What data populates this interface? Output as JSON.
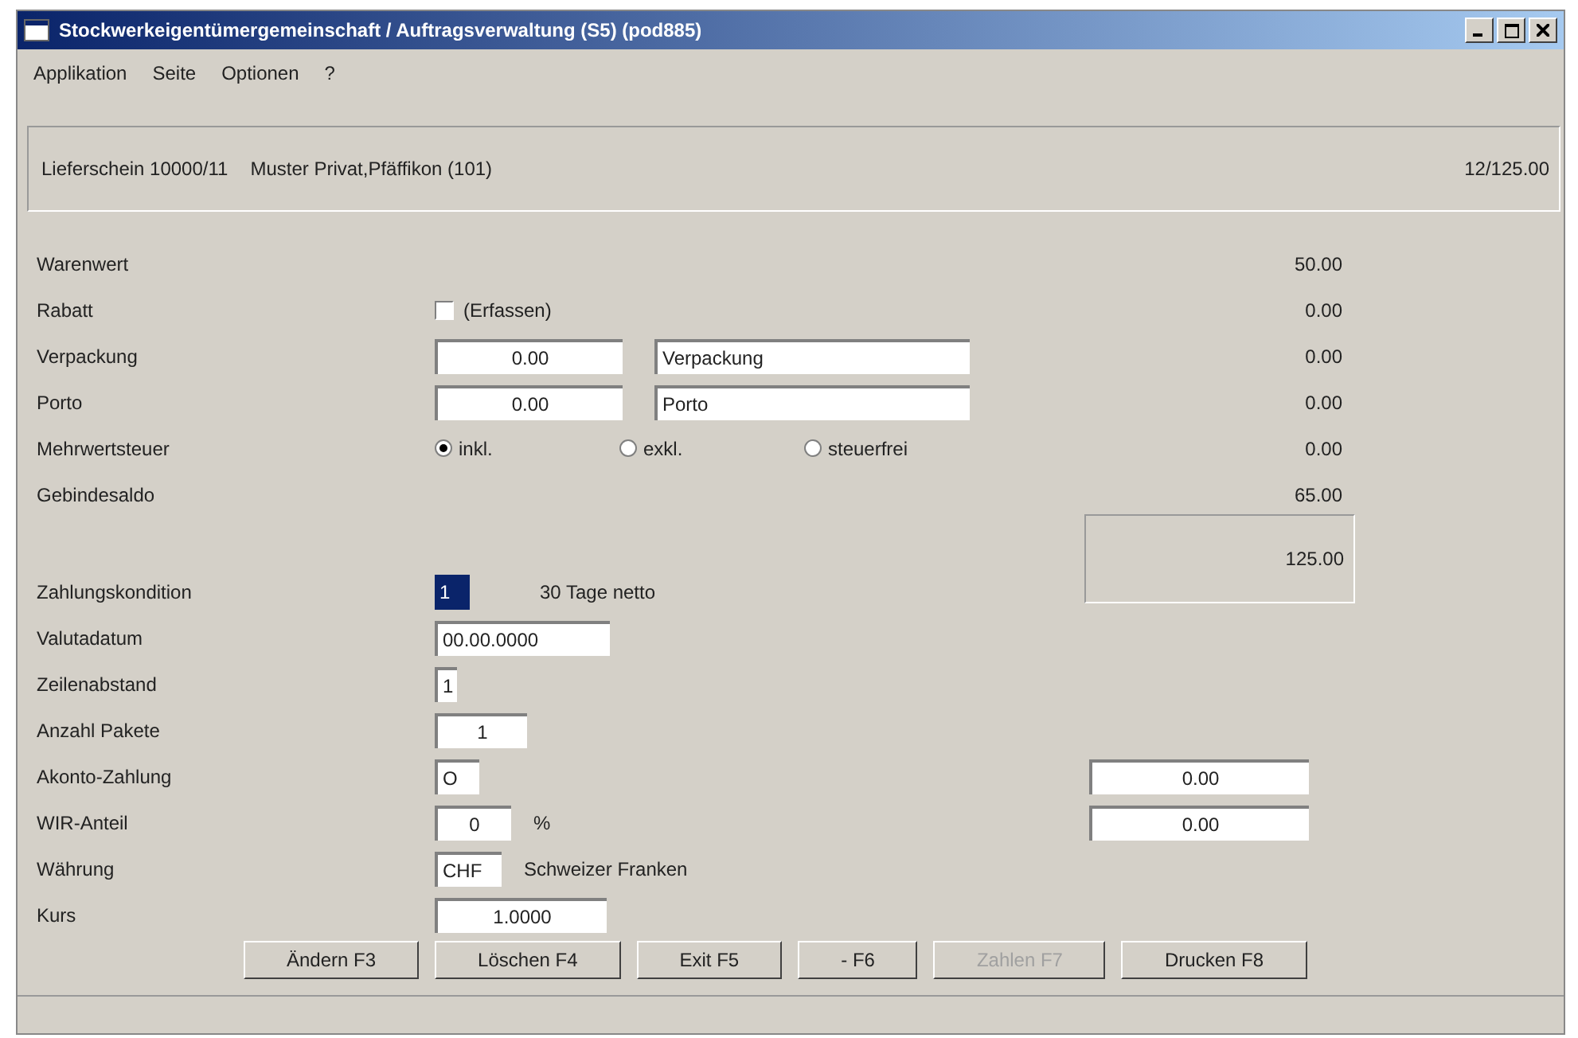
{
  "window": {
    "title": "Stockwerkeigentümergemeinschaft / Auftragsverwaltung (S5) (pod885)"
  },
  "menu": [
    {
      "label": "Applikation"
    },
    {
      "label": "Seite"
    },
    {
      "label": "Optionen"
    },
    {
      "label": "?"
    }
  ],
  "header": {
    "document": "Lieferschein 10000/11",
    "customer": "Muster Privat,Pfäffikon (101)",
    "total": "12/125.00"
  },
  "summary_rows": [
    {
      "kind": "plain",
      "label": "Warenwert",
      "amount": "50.00"
    },
    {
      "kind": "checkbox",
      "label": "Rabatt",
      "check_label": "(Erfassen)",
      "checked": false,
      "amount": "0.00"
    },
    {
      "kind": "fields",
      "label": "Verpackung",
      "value": "0.00",
      "text": "Verpackung",
      "amount": "0.00"
    },
    {
      "kind": "fields",
      "label": "Porto",
      "value": "0.00",
      "text": "Porto",
      "amount": "0.00"
    },
    {
      "kind": "radios",
      "label": "Mehrwertsteuer",
      "options": [
        {
          "label": "inkl.",
          "selected": true
        },
        {
          "label": "exkl.",
          "selected": false
        },
        {
          "label": "steuerfrei",
          "selected": false
        }
      ],
      "amount": "0.00"
    },
    {
      "kind": "plain",
      "label": "Gebindesaldo",
      "amount": "65.00"
    }
  ],
  "total": "125.00",
  "payment_rows": [
    {
      "kind": "code",
      "label": "Zahlungskondition",
      "value": "1",
      "focused": true,
      "note": "30 Tage netto"
    },
    {
      "kind": "field",
      "label": "Valutadatum",
      "value": "00.00.0000"
    },
    {
      "kind": "field",
      "label": "Zeilenabstand",
      "value": "1"
    },
    {
      "kind": "field",
      "label": "Anzahl Pakete",
      "value": "1"
    },
    {
      "kind": "field",
      "label": "Akonto-Zahlung",
      "value": "O",
      "right_value": "0.00"
    },
    {
      "kind": "field",
      "label": "WIR-Anteil",
      "value": "0",
      "note": "%",
      "right_value": "0.00"
    },
    {
      "kind": "field",
      "label": "Währung",
      "value": "CHF",
      "note": "Schweizer Franken"
    },
    {
      "kind": "field",
      "label": "Kurs",
      "value": "1.0000"
    }
  ],
  "buttons": [
    {
      "label": "Ändern F3",
      "disabled": false
    },
    {
      "label": "Löschen F4",
      "disabled": false
    },
    {
      "label": "Exit F5",
      "disabled": false
    },
    {
      "label": "- F6",
      "disabled": false
    },
    {
      "label": "Zahlen F7",
      "disabled": true
    },
    {
      "label": "Drucken F8",
      "disabled": false
    }
  ]
}
